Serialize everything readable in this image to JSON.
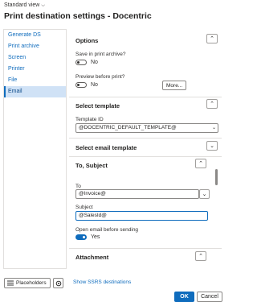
{
  "header": {
    "view_label": "Standard view",
    "title": "Print destination settings - Docentric"
  },
  "nav": {
    "items": [
      {
        "label": "Generate DS"
      },
      {
        "label": "Print archive"
      },
      {
        "label": "Screen"
      },
      {
        "label": "Printer"
      },
      {
        "label": "File"
      },
      {
        "label": "Email",
        "selected": true
      }
    ]
  },
  "options": {
    "title": "Options",
    "save_in_archive": {
      "label": "Save in print archive?",
      "value": "No",
      "checked": false
    },
    "preview_before_print": {
      "label": "Preview before print?",
      "value": "No",
      "checked": false
    },
    "more_label": "More..."
  },
  "select_template": {
    "title": "Select template",
    "template_id_label": "Template ID",
    "template_id_value": "@DOCENTRIC_DEFAULT_TEMPLATE@"
  },
  "select_email_template": {
    "title": "Select email template"
  },
  "to_subject": {
    "title": "To, Subject",
    "to_label": "To",
    "to_value": "@Invoice@",
    "subject_label": "Subject",
    "subject_value": "@SalesId@",
    "open_email": {
      "label": "Open email before sending",
      "value": "Yes",
      "checked": true
    }
  },
  "attachment": {
    "title": "Attachment"
  },
  "footer": {
    "placeholders_label": "Placeholders",
    "ssrs_link": "Show SSRS destinations",
    "ok_label": "OK",
    "cancel_label": "Cancel"
  },
  "icons": {
    "chevron_up": "⌃",
    "chevron_down": "⌄",
    "placeholders_icon": "list-icon",
    "settings_icon": "gear-icon"
  },
  "colors": {
    "accent": "#0f6cbd",
    "selected_nav_bg": "#d0e2f6",
    "border": "#e1dfdd"
  }
}
